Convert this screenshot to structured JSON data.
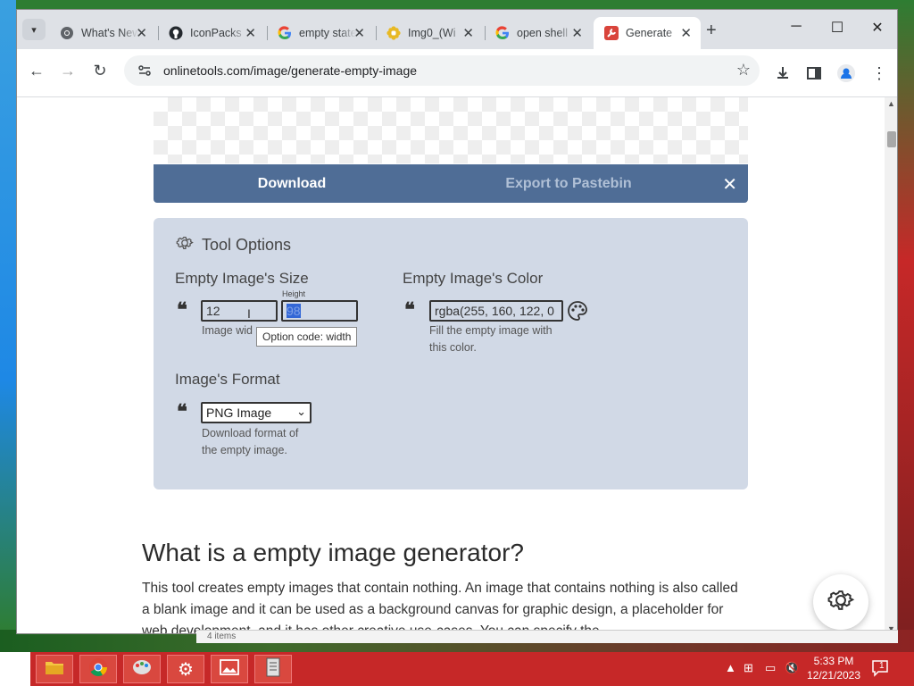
{
  "browser": {
    "tabs": [
      {
        "title": "What's New",
        "icon": "chrome-icon"
      },
      {
        "title": "IconPacks",
        "icon": "github-icon"
      },
      {
        "title": "empty state",
        "icon": "google-icon"
      },
      {
        "title": "Img0_(Wi",
        "icon": "flower-icon"
      },
      {
        "title": "open shell",
        "icon": "google-icon"
      },
      {
        "title": "Generate",
        "icon": "wrench-icon",
        "active": true
      }
    ],
    "url": "onlinetools.com/image/generate-empty-image"
  },
  "download_bar": {
    "download_label": "Download",
    "export_label": "Export to Pastebin"
  },
  "tool_options": {
    "title": "Tool Options",
    "size": {
      "heading": "Empty Image's Size",
      "width_value": "12",
      "height_label": "Height",
      "height_value": "98",
      "hint": "Image wid",
      "tooltip": "Option code: width"
    },
    "color": {
      "heading": "Empty Image's Color",
      "value": "rgba(255, 160, 122, 0",
      "hint_line1": "Fill the empty image with",
      "hint_line2": "this color."
    },
    "format": {
      "heading": "Image's Format",
      "selected": "PNG Image",
      "hint_line1": "Download format of",
      "hint_line2": "the empty image."
    }
  },
  "article": {
    "heading": "What is a empty image generator?",
    "paragraph": "This tool creates empty images that contain nothing. An image that contains nothing is also called a blank image and it can be used as a background canvas for graphic design, a placeholder for web development, and it has other creative use-cases. You can specify the"
  },
  "behind_window": {
    "text": "4 items"
  },
  "taskbar": {
    "time": "5:33 PM",
    "date": "12/21/2023",
    "notification_count": "1"
  },
  "colors": {
    "download_bar": "#4f6d96",
    "options_bg": "#d1d9e6",
    "taskbar": "#c62828"
  }
}
